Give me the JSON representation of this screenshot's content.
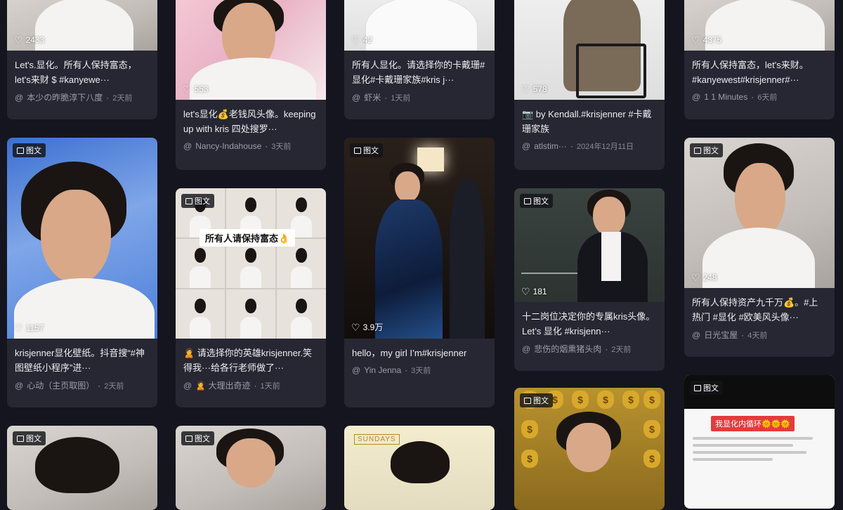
{
  "tag_label": "图文",
  "columns": [
    {
      "cards": [
        {
          "likes": "2433",
          "title": "Let's.显化。所有人保持富态，let's来财 $ #kanyewe···",
          "author": "本少の昨脆淳下八度",
          "time": "2天前"
        },
        {
          "tag": "图文",
          "likes": "1157",
          "title": "krisjenner显化壁纸。抖音搜“#神图壁纸小程序”进···",
          "author": "心动（主页取图）",
          "time": "2天前"
        },
        {
          "tag": "图文"
        }
      ]
    },
    {
      "cards": [
        {
          "likes": "553",
          "title": "let's显化💰老钱风头像。keeping up with kris 四处搜罗···",
          "author": "Nancy-Indahouse",
          "time": "3天前"
        },
        {
          "tag": "图文",
          "overlay": "所有人请保持富态👌",
          "title": "🙎 请选择你的英雄krisjenner.笑得我···给各行老师做了···",
          "author": "🙎 大理出奇迹",
          "time": "1天前"
        },
        {
          "tag": "图文"
        }
      ]
    },
    {
      "cards": [
        {
          "likes": "42",
          "title": "所有人显化。请选择你的卡戴珊#显化#卡戴珊家族#kris j···",
          "author": "虾米",
          "time": "1天前"
        },
        {
          "tag": "图文",
          "likes": "3.9万",
          "title": "hello，my girl I’m#krisjenner",
          "author": "Yin Jenna",
          "time": "3天前"
        },
        {
          "banner": "SUNDAYS"
        }
      ]
    },
    {
      "cards": [
        {
          "likes": "578",
          "title": "📷 by Kendall.#krisjenner #卡戴珊家族",
          "author": "atlstim···",
          "time": "2024年12月11日"
        },
        {
          "tag": "图文",
          "likes": "181",
          "title": "十二岗位决定你的专属kris头像。Let’s 显化 #krisjenn···",
          "author": "悲伤的烟熏猪头肉",
          "time": "2天前"
        },
        {
          "tag": "图文"
        }
      ]
    },
    {
      "cards": [
        {
          "likes": "4375",
          "title": "所有人保持富态，let's来财。#kanyewest#krisjenner#···",
          "author": "1 1 Minutes",
          "time": "6天前"
        },
        {
          "tag": "图文",
          "likes": "248",
          "title": "所有人保持资产九千万💰。#上热门 #显化 #欧美风头像···",
          "author": "日光宝屋",
          "time": "4天前"
        },
        {
          "tag": "图文",
          "badge": "我显化内循环🌞🌞🌞"
        }
      ]
    }
  ],
  "colors": {
    "page_bg": "#15151f",
    "card_bg": "#272733",
    "meta": "#9d9daa"
  }
}
